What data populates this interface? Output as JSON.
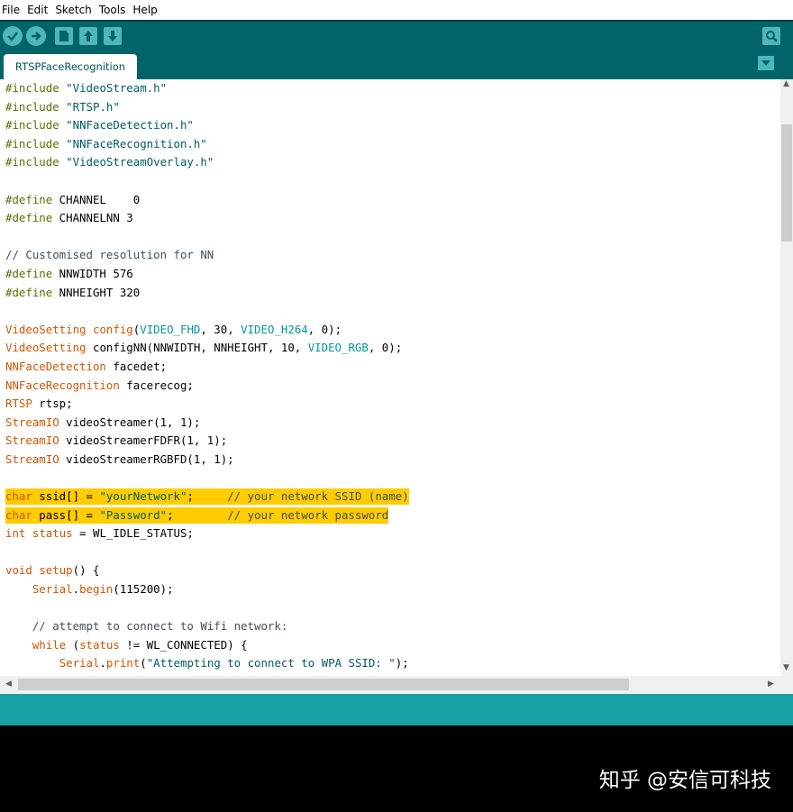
{
  "menu": [
    "File",
    "Edit",
    "Sketch",
    "Tools",
    "Help"
  ],
  "toolbar": {
    "icons": [
      "verify-icon",
      "upload-icon",
      "new-icon",
      "open-icon",
      "save-icon",
      "serial-monitor-icon"
    ]
  },
  "tab": {
    "label": "RTSPFaceRecognition"
  },
  "code": [
    [
      [
        "pp",
        "#include"
      ],
      [
        "",
        " "
      ],
      [
        "st",
        "\"VideoStream.h\""
      ]
    ],
    [
      [
        "pp",
        "#include"
      ],
      [
        "",
        " "
      ],
      [
        "st",
        "\"RTSP.h\""
      ]
    ],
    [
      [
        "pp",
        "#include"
      ],
      [
        "",
        " "
      ],
      [
        "st",
        "\"NNFaceDetection.h\""
      ]
    ],
    [
      [
        "pp",
        "#include"
      ],
      [
        "",
        " "
      ],
      [
        "st",
        "\"NNFaceRecognition.h\""
      ]
    ],
    [
      [
        "pp",
        "#include"
      ],
      [
        "",
        " "
      ],
      [
        "st",
        "\"VideoStreamOverlay.h\""
      ]
    ],
    [],
    [
      [
        "pp",
        "#define"
      ],
      [
        "",
        " CHANNEL    0"
      ]
    ],
    [
      [
        "pp",
        "#define"
      ],
      [
        "",
        " CHANNELNN 3"
      ]
    ],
    [],
    [
      [
        "cm",
        "// Customised resolution for NN"
      ]
    ],
    [
      [
        "pp",
        "#define"
      ],
      [
        "",
        " NNWIDTH 576"
      ]
    ],
    [
      [
        "pp",
        "#define"
      ],
      [
        "",
        " NNHEIGHT 320"
      ]
    ],
    [],
    [
      [
        "ty",
        "VideoSetting"
      ],
      [
        "",
        " "
      ],
      [
        "kw",
        "config"
      ],
      [
        "",
        "("
      ],
      [
        "cn",
        "VIDEO_FHD"
      ],
      [
        "",
        ", 30, "
      ],
      [
        "cn",
        "VIDEO_H264"
      ],
      [
        "",
        ", 0);"
      ]
    ],
    [
      [
        "ty",
        "VideoSetting"
      ],
      [
        "",
        " configNN(NNWIDTH, NNHEIGHT, 10, "
      ],
      [
        "cn",
        "VIDEO_RGB"
      ],
      [
        "",
        ", 0);"
      ]
    ],
    [
      [
        "ty",
        "NNFaceDetection"
      ],
      [
        "",
        " facedet;"
      ]
    ],
    [
      [
        "ty",
        "NNFaceRecognition"
      ],
      [
        "",
        " facerecog;"
      ]
    ],
    [
      [
        "ty",
        "RTSP"
      ],
      [
        "",
        " rtsp;"
      ]
    ],
    [
      [
        "ty",
        "StreamIO"
      ],
      [
        "",
        " videoStreamer(1, 1);"
      ]
    ],
    [
      [
        "ty",
        "StreamIO"
      ],
      [
        "",
        " videoStreamerFDFR(1, 1);"
      ]
    ],
    [
      [
        "ty",
        "StreamIO"
      ],
      [
        "",
        " videoStreamerRGBFD(1, 1);"
      ]
    ],
    [],
    [
      [
        "kw",
        "char"
      ],
      [
        "",
        " ssid[] = "
      ],
      [
        "st",
        "\"yourNetwork\""
      ],
      [
        "",
        ";     "
      ],
      [
        "cm",
        "// your network SSID (name)"
      ]
    ],
    [
      [
        "kw",
        "char"
      ],
      [
        "",
        " pass[] = "
      ],
      [
        "st",
        "\"Password\""
      ],
      [
        "",
        ";        "
      ],
      [
        "cm",
        "// your network password"
      ]
    ],
    [
      [
        "kw",
        "int"
      ],
      [
        "",
        " "
      ],
      [
        "kw",
        "status"
      ],
      [
        "",
        " = WL_IDLE_STATUS;"
      ]
    ],
    [],
    [
      [
        "kw",
        "void"
      ],
      [
        "",
        " "
      ],
      [
        "kw",
        "setup"
      ],
      [
        "",
        "() {"
      ]
    ],
    [
      [
        "",
        "    "
      ],
      [
        "kw",
        "Serial"
      ],
      [
        "",
        "."
      ],
      [
        "kw",
        "begin"
      ],
      [
        "",
        "(115200);"
      ]
    ],
    [],
    [
      [
        "",
        "    "
      ],
      [
        "cm",
        "// attempt to connect to Wifi network:"
      ]
    ],
    [
      [
        "",
        "    "
      ],
      [
        "kw",
        "while"
      ],
      [
        "",
        " ("
      ],
      [
        "kw",
        "status"
      ],
      [
        "",
        " != WL_CONNECTED) {"
      ]
    ],
    [
      [
        "",
        "        "
      ],
      [
        "kw",
        "Serial"
      ],
      [
        "",
        "."
      ],
      [
        "kw",
        "print"
      ],
      [
        "",
        "("
      ],
      [
        "st",
        "\"Attempting to connect to WPA SSID: \""
      ],
      [
        "",
        ");"
      ]
    ]
  ],
  "highlighted_lines": [
    22,
    23
  ],
  "watermark": "知乎 @安信可科技"
}
